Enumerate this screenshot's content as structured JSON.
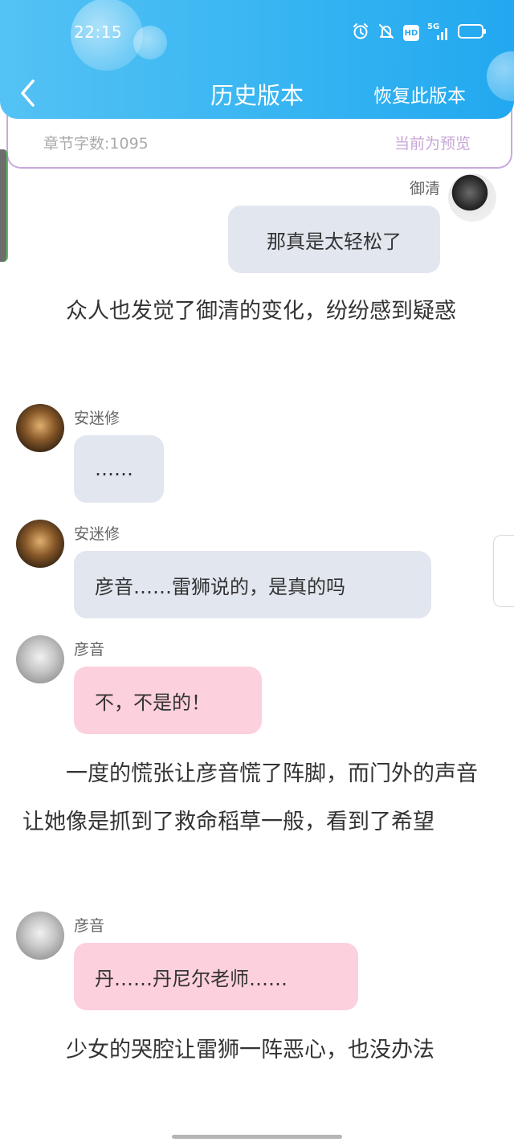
{
  "status_bar": {
    "time": "22:15",
    "icons": [
      "alarm-icon",
      "mute-bell-icon",
      "hd-icon",
      "5g-signal-icon",
      "battery-icon"
    ],
    "hd_label": "HD",
    "network_label": "5G"
  },
  "header": {
    "title": "历史版本",
    "restore_label": "恢复此版本",
    "gradient_colors": [
      "#54c2f4",
      "#22a8f0"
    ]
  },
  "info": {
    "word_count": "章节字数:1095",
    "preview_label": "当前为预览"
  },
  "messages": [
    {
      "speaker": "御清",
      "text": "那真是太轻松了",
      "side": "right",
      "color": "grey"
    },
    {
      "narration": "众人也发觉了御清的变化，纷纷感到疑惑"
    },
    {
      "speaker": "安迷修",
      "text": "……",
      "side": "left",
      "color": "grey"
    },
    {
      "speaker": "安迷修",
      "text": "彦音……雷狮说的，是真的吗",
      "side": "left",
      "color": "grey"
    },
    {
      "speaker": "彦音",
      "text": "不，不是的！",
      "side": "left",
      "color": "pink"
    },
    {
      "narration": "一度的慌张让彦音慌了阵脚，而门外的声音让她像是抓到了救命稻草一般，看到了希望"
    },
    {
      "speaker": "彦音",
      "text": "丹……丹尼尔老师……",
      "side": "left",
      "color": "pink"
    },
    {
      "narration": "少女的哭腔让雷狮一阵恶心，也没办法"
    }
  ],
  "colors": {
    "grey_bubble": "#e1e6ef",
    "pink_bubble": "#fdd0dd",
    "preview_text": "#c8a6d8"
  }
}
